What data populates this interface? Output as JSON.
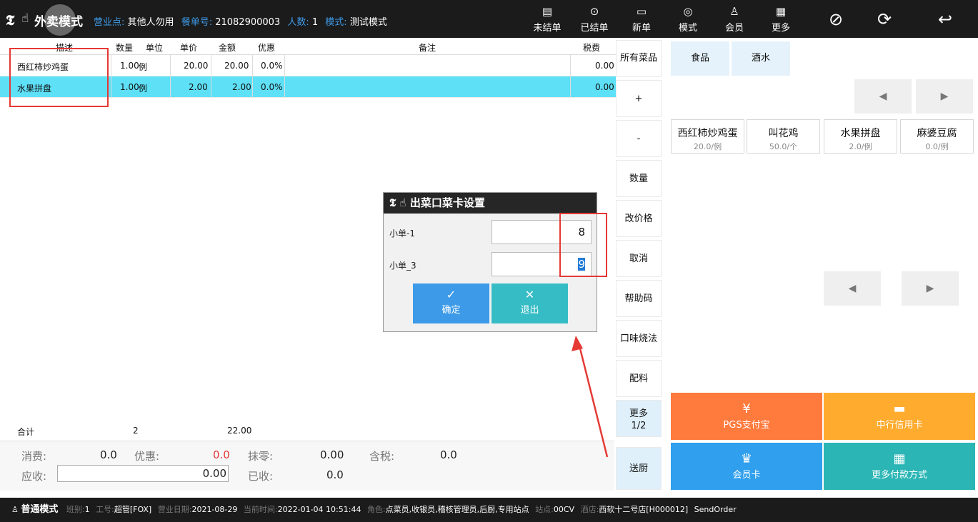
{
  "header": {
    "logo": "𝕿",
    "logo_hand": "☝",
    "mode_title": "外卖模式",
    "info": [
      {
        "label": "营业点:",
        "value": "其他人勿用"
      },
      {
        "label": "餐单号:",
        "value": "21082900003"
      },
      {
        "label": "人数:",
        "value": "1"
      },
      {
        "label": "模式:",
        "value": "测试模式"
      }
    ],
    "buttons": [
      {
        "label": "未结单",
        "icon": "▤"
      },
      {
        "label": "已结单",
        "icon": "⊙"
      },
      {
        "label": "新单",
        "icon": "▭"
      },
      {
        "label": "模式",
        "icon": "◎"
      },
      {
        "label": "会员",
        "icon": "♙"
      },
      {
        "label": "更多",
        "icon": "▦"
      }
    ],
    "icons": {
      "no_service": "⊘",
      "refresh": "⟳",
      "back": "↩"
    }
  },
  "table": {
    "columns": [
      "描述",
      "数量",
      "单位",
      "单价",
      "金额",
      "优惠",
      "备注",
      "税费"
    ],
    "rows": [
      {
        "name": "西红柿炒鸡蛋",
        "qty": "1.00",
        "unit": "例",
        "price": "20.00",
        "amount": "20.00",
        "discount": "0.0%",
        "remark": "",
        "tax": "0.00"
      },
      {
        "name": "水果拼盘",
        "qty": "1.00",
        "unit": "例",
        "price": "2.00",
        "amount": "2.00",
        "discount": "0.0%",
        "remark": "",
        "tax": "0.00"
      }
    ],
    "summary": {
      "label": "合计",
      "qty": "2",
      "amount": "22.00"
    }
  },
  "totals": {
    "consume_label": "消费:",
    "consume": "0.0",
    "discount_label": "优惠:",
    "discount": "0.0",
    "rounding_label": "抹零:",
    "rounding": "0.00",
    "tax_label": "含税:",
    "tax": "0.0",
    "receivable_label": "应收:",
    "receivable": "0.00",
    "received_label": "已收:",
    "received": "0.0"
  },
  "commands": [
    "所有菜品",
    "+",
    "-",
    "数量",
    "改价格",
    "取消",
    "帮助码",
    "口味烧法",
    "配料",
    "更多\n1/2",
    "送厨"
  ],
  "categories": [
    "食品",
    "酒水"
  ],
  "pager": {
    "prev": "◀",
    "next": "▶"
  },
  "dishes": [
    {
      "name": "西红柿炒鸡蛋",
      "price": "20.0/例"
    },
    {
      "name": "叫花鸡",
      "price": "50.0/个"
    },
    {
      "name": "水果拼盘",
      "price": "2.0/例"
    },
    {
      "name": "麻婆豆腐",
      "price": "0.0/例"
    }
  ],
  "payments": [
    {
      "label": "PGS支付宝",
      "icon": "¥",
      "color": "#ff7a3d"
    },
    {
      "label": "中行信用卡",
      "icon": "▬",
      "color": "#ffab2e"
    },
    {
      "label": "会员卡",
      "icon": "♛",
      "color": "#2f9fee"
    },
    {
      "label": "更多付款方式",
      "icon": "▦",
      "color": "#2bb5b5"
    }
  ],
  "dialog": {
    "title": "出菜口菜卡设置",
    "fields": [
      {
        "label": "小单-1",
        "value": "8"
      },
      {
        "label": "小单_3",
        "value": "9"
      }
    ],
    "confirm": {
      "label": "确定",
      "icon": "✓",
      "color": "#3d9ae8"
    },
    "exit": {
      "label": "退出",
      "icon": "✕",
      "color": "#36bcc4"
    }
  },
  "statusbar": {
    "mode": "普通模式",
    "items": [
      {
        "label": "班别:",
        "value": "1"
      },
      {
        "label": "工号:",
        "value": "超管[FOX]"
      },
      {
        "label": "营业日期:",
        "value": "2021-08-29"
      },
      {
        "label": "当前时间:",
        "value": "2022-01-04 10:51:44"
      },
      {
        "label": "角色:",
        "value": "点菜员,收银员,稽核管理员,后厨,专用站点"
      },
      {
        "label": "站点:",
        "value": "00CV"
      },
      {
        "label": "酒店:",
        "value": "西软十二号店[H000012]"
      },
      {
        "label": "",
        "value": "SendOrder"
      }
    ]
  }
}
